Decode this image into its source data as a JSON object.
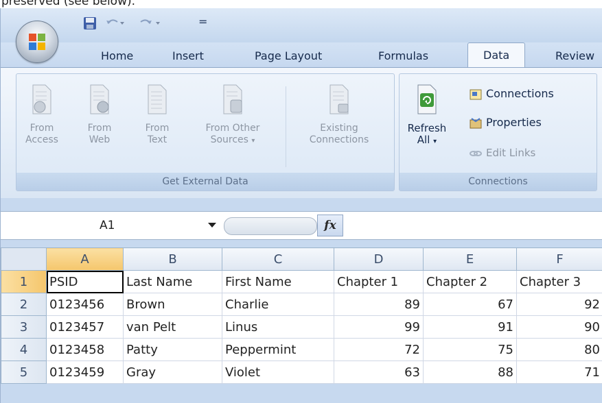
{
  "caption": "preserved (see below).",
  "quick_access": {
    "save_icon": "save-icon",
    "undo_icon": "undo-icon",
    "redo_icon": "redo-icon",
    "customize": "="
  },
  "tabs": [
    "Home",
    "Insert",
    "Page Layout",
    "Formulas",
    "Data",
    "Review"
  ],
  "active_tab": "Data",
  "ribbon": {
    "get_external_data": {
      "label": "Get External Data",
      "from_access": [
        "From",
        "Access"
      ],
      "from_web": [
        "From",
        "Web"
      ],
      "from_text": [
        "From",
        "Text"
      ],
      "from_other": [
        "From Other",
        "Sources"
      ],
      "existing": [
        "Existing",
        "Connections"
      ]
    },
    "connections": {
      "label": "Connections",
      "refresh": [
        "Refresh",
        "All"
      ],
      "connections": "Connections",
      "properties": "Properties",
      "edit_links": "Edit Links"
    }
  },
  "formula_bar": {
    "name_box": "A1",
    "fx": "fx",
    "formula": ""
  },
  "grid": {
    "columns": [
      "A",
      "B",
      "C",
      "D",
      "E",
      "F"
    ],
    "rows": [
      {
        "num": "1",
        "cells": [
          "PSID",
          "Last Name",
          "First Name",
          "Chapter 1",
          "Chapter 2",
          "Chapter 3"
        ]
      },
      {
        "num": "2",
        "cells": [
          "0123456",
          "Brown",
          "Charlie",
          "89",
          "67",
          "92"
        ]
      },
      {
        "num": "3",
        "cells": [
          "0123457",
          "van Pelt",
          "Linus",
          "99",
          "91",
          "90"
        ]
      },
      {
        "num": "4",
        "cells": [
          "0123458",
          "Patty",
          "Peppermint",
          "72",
          "75",
          "80"
        ]
      },
      {
        "num": "5",
        "cells": [
          "0123459",
          "Gray",
          "Violet",
          "63",
          "88",
          "71"
        ]
      }
    ]
  }
}
